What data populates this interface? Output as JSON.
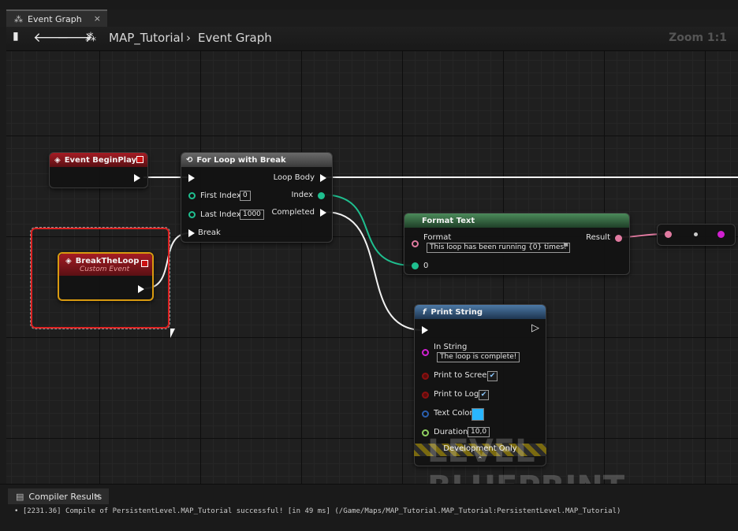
{
  "tab": {
    "label": "Event Graph",
    "close": "×"
  },
  "graph_header": {
    "breadcrumb_map": "MAP_Tutorial",
    "breadcrumb_sep": "›",
    "breadcrumb_graph": "Event Graph",
    "zoom": "Zoom 1:1"
  },
  "nodes": {
    "begin_play": {
      "title": "Event BeginPlay"
    },
    "break_loop": {
      "title": "BreakTheLoop",
      "subtitle": "Custom Event"
    },
    "for_loop": {
      "title": "For Loop with Break",
      "first_index_label": "First Index",
      "first_index_value": "0",
      "last_index_label": "Last Index",
      "last_index_value": "1000",
      "break_label": "Break",
      "loop_body_label": "Loop Body",
      "index_label": "Index",
      "completed_label": "Completed"
    },
    "format_text": {
      "title": "Format Text",
      "format_label": "Format",
      "format_value": "This loop has been running {0} times!",
      "arg_label": "0",
      "result_label": "Result"
    },
    "print_string": {
      "title": "Print String",
      "in_string_label": "In String",
      "in_string_value": "The loop is complete!",
      "print_screen_label": "Print to Screen",
      "print_log_label": "Print to Log",
      "text_color_label": "Text Color",
      "text_color_value": "#29b6ff",
      "duration_label": "Duration",
      "duration_value": "10,0",
      "dev_only": "Development Only"
    }
  },
  "watermark": "LEVEL BLUEPRINT",
  "compiler": {
    "tab_label": "Compiler Results",
    "close": "×",
    "log": "• [2231.36] Compile of PersistentLevel.MAP_Tutorial successful! [in 49 ms] (/Game/Maps/MAP_Tutorial.MAP_Tutorial:PersistentLevel.MAP_Tutorial)"
  }
}
